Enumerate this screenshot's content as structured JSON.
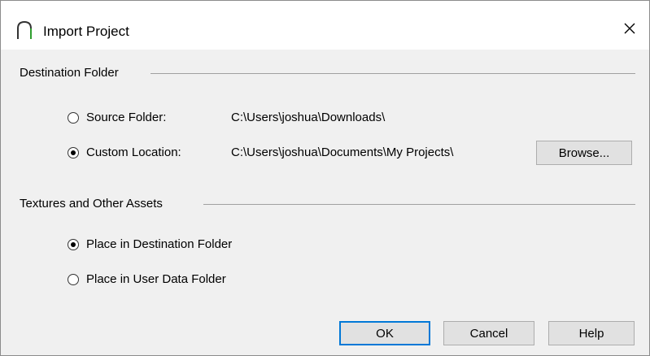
{
  "window": {
    "title": "Import Project",
    "close_glyph": "✕"
  },
  "destination": {
    "header": "Destination Folder",
    "options": [
      {
        "label": "Source Folder:",
        "path": "C:\\Users\\joshua\\Downloads\\",
        "checked": false
      },
      {
        "label": "Custom Location:",
        "path": "C:\\Users\\joshua\\Documents\\My Projects\\",
        "checked": true
      }
    ],
    "browse_label": "Browse..."
  },
  "assets": {
    "header": "Textures and Other Assets",
    "options": [
      {
        "label": "Place in Destination Folder",
        "checked": true
      },
      {
        "label": "Place in User Data Folder",
        "checked": false
      }
    ]
  },
  "buttons": {
    "ok": "OK",
    "cancel": "Cancel",
    "help": "Help"
  },
  "colors": {
    "accent": "#0078d7",
    "icon_stroke": "#1e7a1e"
  }
}
